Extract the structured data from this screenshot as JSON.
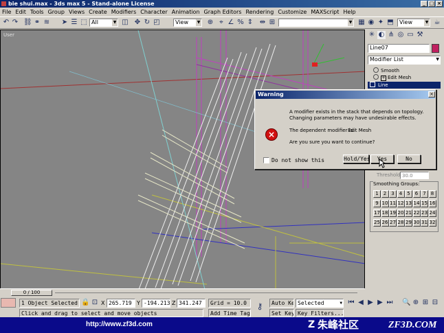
{
  "window": {
    "title": "bie shui.max - 3ds max 5 - Stand-alone License"
  },
  "menu": [
    "File",
    "Edit",
    "Tools",
    "Group",
    "Views",
    "Create",
    "Modifiers",
    "Character",
    "Animation",
    "Graph Editors",
    "Rendering",
    "Customize",
    "MAXScript",
    "Help"
  ],
  "toolbar": {
    "selection_filter": "All",
    "reference_coord": "View",
    "right_view": "View"
  },
  "viewport": {
    "label": "User"
  },
  "panel": {
    "object_name": "Line07",
    "modifier_list": "Modifier List",
    "stack": [
      "Smooth",
      "Edit Mesh",
      "Line"
    ],
    "threshold_label": "Threshold:",
    "threshold_value": "30.0",
    "smoothing_label": "Smoothing Groups:",
    "smoothing_groups": [
      "1",
      "2",
      "3",
      "4",
      "5",
      "6",
      "7",
      "8",
      "9",
      "10",
      "11",
      "12",
      "13",
      "14",
      "15",
      "16",
      "17",
      "18",
      "19",
      "20",
      "21",
      "22",
      "23",
      "24",
      "25",
      "26",
      "27",
      "28",
      "29",
      "30",
      "31",
      "32"
    ]
  },
  "dialog": {
    "title": "Warning",
    "line1": "A modifier exists in the stack that depends on topology.",
    "line2": "Changing parameters may have undesirable effects.",
    "dependent_label": "The dependent modifier is:",
    "dependent_value": "Edit Mesh",
    "question": "Are you sure you want to continue?",
    "dont_show": "Do not show this",
    "hold_yes": "Hold/Yes",
    "yes": "Yes",
    "no": "No"
  },
  "timeline": {
    "frame": "0 / 100"
  },
  "status": {
    "selected": "1 Object Selected",
    "hint": "Click and drag to select and move objects",
    "x_label": "X",
    "x_value": "265.719",
    "y_label": "Y",
    "y_value": "-194.213",
    "z_label": "Z",
    "z_value": "341.247",
    "grid": "Grid = 10.0",
    "add_time_tag": "Add Time Tag",
    "auto_key": "Auto Key",
    "set_key": "Set Key",
    "selected_dropdown": "Selected",
    "key_filters": "Key Filters..."
  },
  "footer": {
    "url": "http://www.zf3d.com",
    "brand_cn": "朱峰社区",
    "brand_en": "ZF3D.COM"
  },
  "colors": {
    "title_blue": "#0a246a",
    "viewport_gray": "#858585",
    "footer_blue": "#0a0a8a",
    "selection_highlight": "#0a246a"
  }
}
